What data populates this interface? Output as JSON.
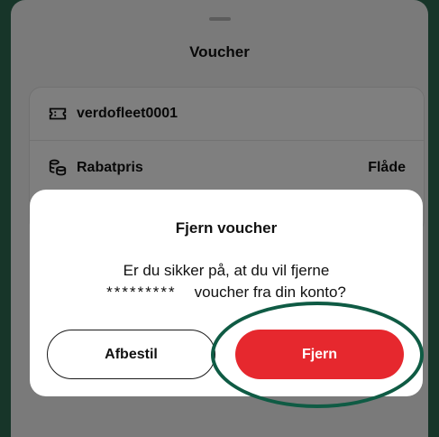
{
  "sheet": {
    "title": "Voucher",
    "voucher_code": "verdofleet0001",
    "price_label": "Rabatpris",
    "price_value": "Flåde"
  },
  "dialog": {
    "title": "Fjern voucher",
    "message_line1": "Er du sikker på, at du vil fjerne",
    "message_masked": "*********",
    "message_line2_rest": "voucher fra din konto?",
    "cancel_label": "Afbestil",
    "confirm_label": "Fjern"
  },
  "colors": {
    "background": "#2f6b52",
    "confirm_button": "#e6282e",
    "highlight_ring": "#0f5b44"
  },
  "icons": {
    "voucher": "ticket-icon",
    "price": "coins-icon"
  }
}
